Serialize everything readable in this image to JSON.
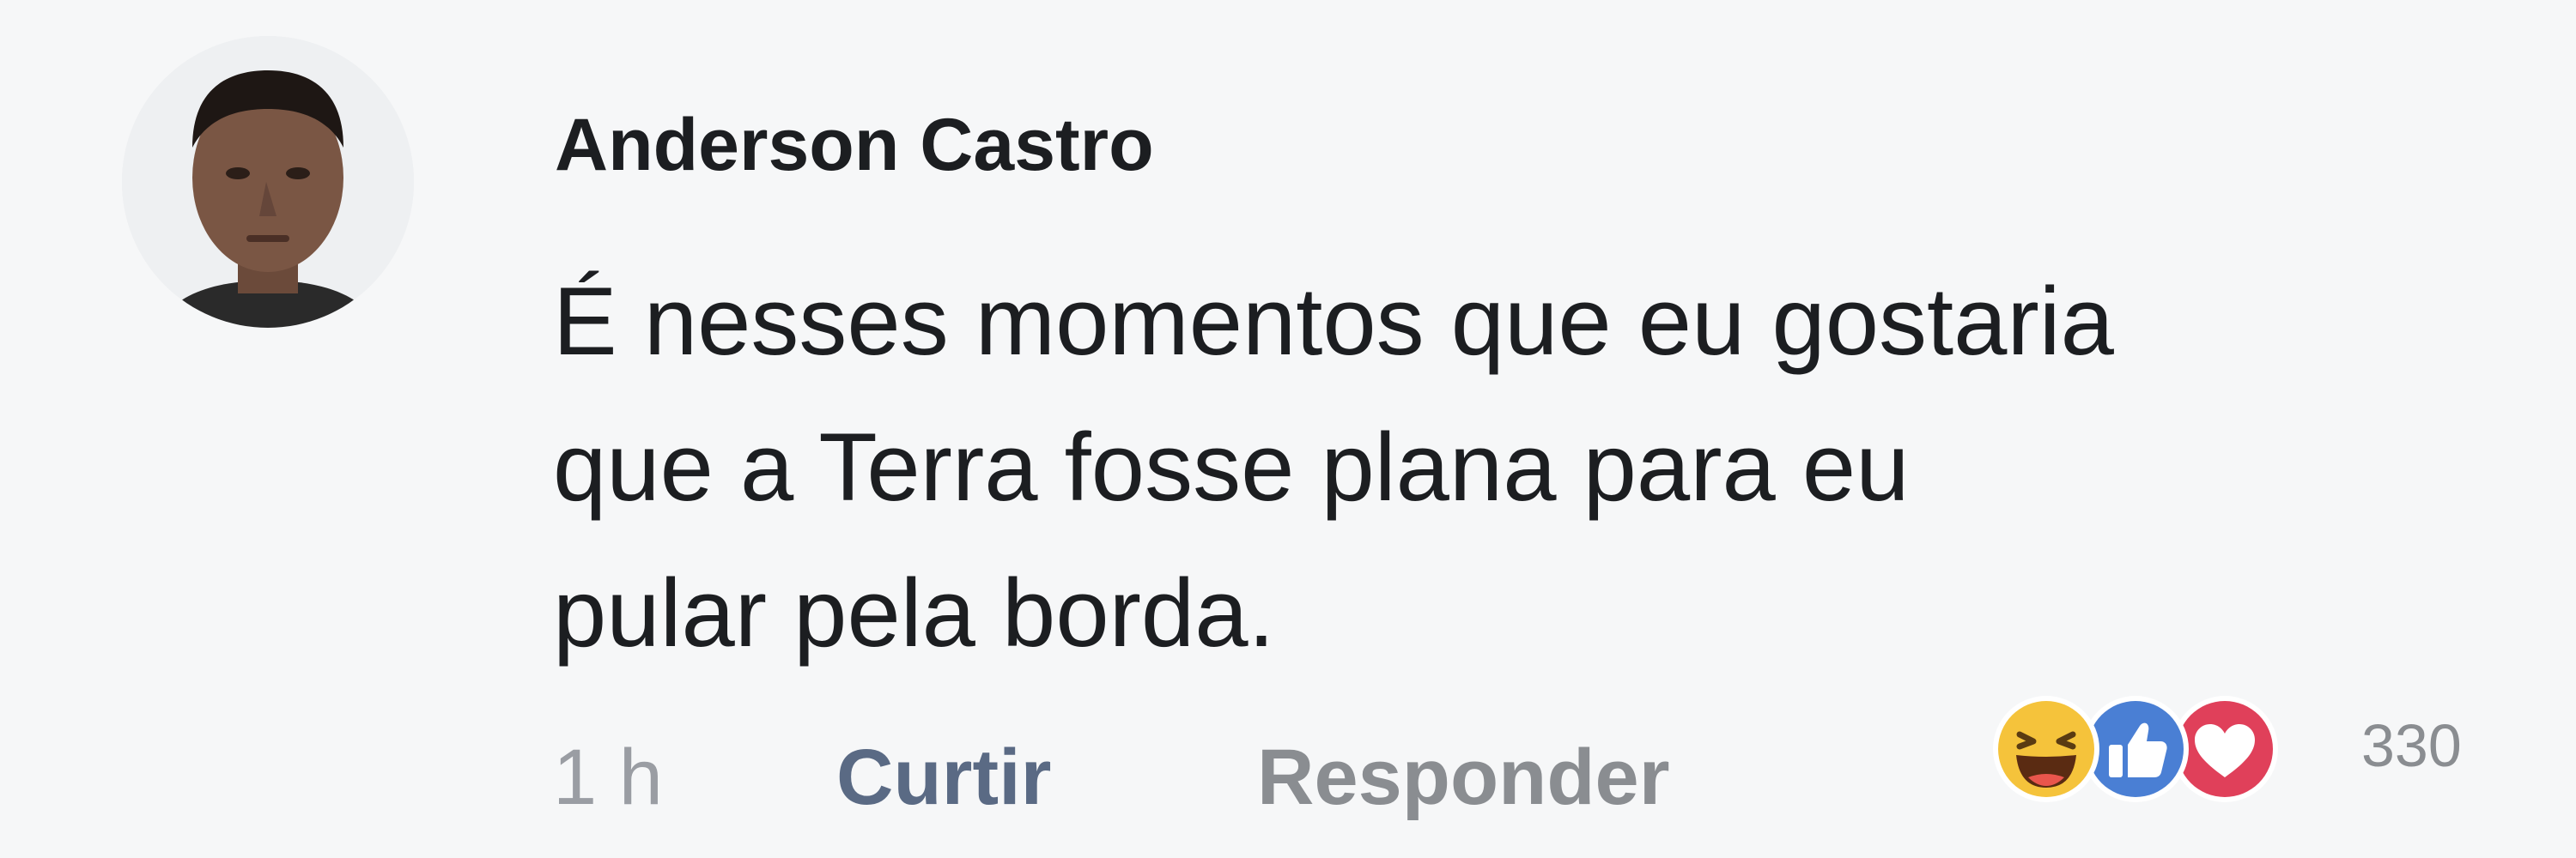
{
  "comment": {
    "author": "Anderson Castro",
    "text_lines": [
      "É nesses momentos que eu gostaria",
      "que a Terra fosse plana para eu",
      "pular pela borda."
    ],
    "timestamp": "1 h",
    "like_label": "Curtir",
    "reply_label": "Responder",
    "reactions": {
      "icons": [
        "haha-reaction-icon",
        "like-reaction-icon",
        "love-reaction-icon"
      ],
      "count": "330"
    }
  },
  "colors": {
    "background": "#f6f7f8",
    "like_blue": "#4a7fd4",
    "love_red": "#e0405a",
    "haha_yellow": "#f5c33b",
    "link_gray": "#8a8d91"
  }
}
